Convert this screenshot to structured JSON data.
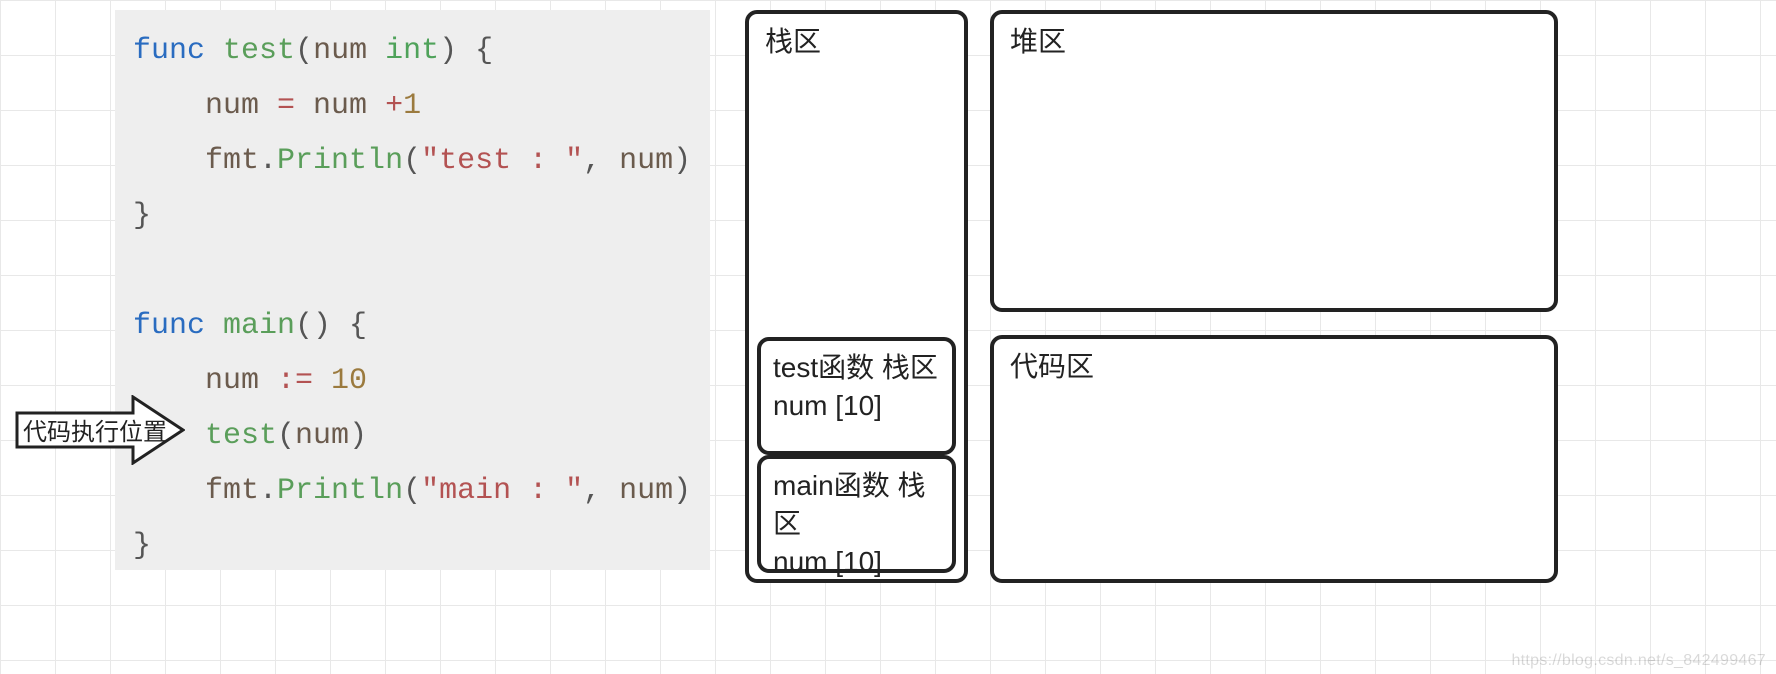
{
  "execution_pointer_label": "代码执行位置",
  "code": {
    "line1": {
      "kw": "func",
      "fn": "test",
      "p1": "(",
      "id": "num",
      "ty": "int",
      "p2": ") {"
    },
    "line2": {
      "indent": "    ",
      "id1": "num",
      "op1": " = ",
      "id2": "num",
      "op2": " +",
      "num": "1"
    },
    "line3": {
      "indent": "    ",
      "id": "fmt",
      "dot": ".",
      "fn": "Println",
      "p1": "(",
      "str": "\"test : \"",
      "comma": ", ",
      "id2": "num",
      "p2": ")"
    },
    "line4": {
      "p": "}"
    },
    "line5": {
      "blank": ""
    },
    "line6": {
      "kw": "func",
      "fn": "main",
      "p1": "() {"
    },
    "line7": {
      "indent": "    ",
      "id": "num",
      "op": " := ",
      "num": "10"
    },
    "line8": {
      "indent": "    ",
      "fn": "test",
      "p1": "(",
      "id": "num",
      "p2": ")"
    },
    "line9": {
      "indent": "    ",
      "id": "fmt",
      "dot": ".",
      "fn": "Println",
      "p1": "(",
      "str": "\"main : \"",
      "comma": ", ",
      "id2": "num",
      "p2": ")"
    },
    "line10": {
      "p": "}"
    }
  },
  "regions": {
    "stack": {
      "title": "栈区"
    },
    "heap": {
      "title": "堆区"
    },
    "code": {
      "title": "代码区"
    }
  },
  "stack_frames": {
    "test": {
      "line1": "test函数 栈区",
      "line2": "num [10]"
    },
    "main": {
      "line1": "main函数 栈区",
      "line2": "num [10]"
    }
  },
  "watermark": "https://blog.csdn.net/s_842499467"
}
